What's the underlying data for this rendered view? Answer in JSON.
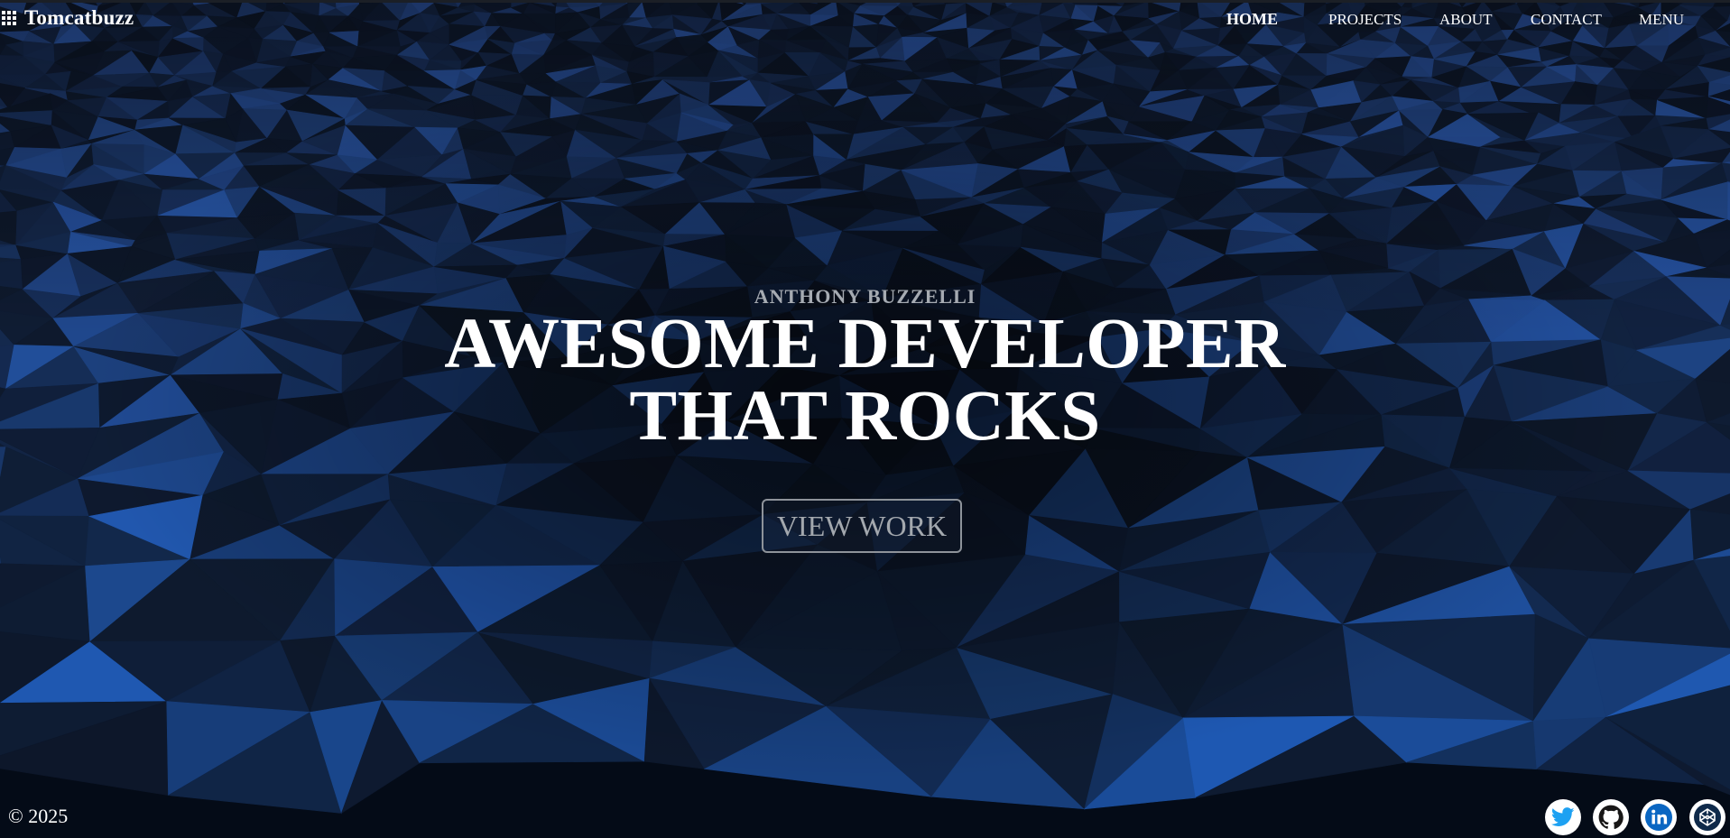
{
  "brand": {
    "name": "Tomcatbuzz",
    "icon": "apps-grid-icon"
  },
  "nav": {
    "items": [
      {
        "label": "HOME",
        "active": true
      },
      {
        "label": "PROJECTS",
        "active": false
      },
      {
        "label": "ABOUT",
        "active": false
      },
      {
        "label": "CONTACT",
        "active": false
      },
      {
        "label": "MENU",
        "active": false
      }
    ]
  },
  "hero": {
    "subtitle": "ANTHONY BUZZELLI",
    "headline_line1": "AWESOME DEVELOPER",
    "headline_line2": "THAT ROCKS",
    "cta_label": "VIEW WORK"
  },
  "footer": {
    "copyright": "© 2025",
    "socials": [
      {
        "name": "twitter-icon",
        "color": "#1da1f2"
      },
      {
        "name": "github-icon",
        "color": "#181717"
      },
      {
        "name": "linkedin-icon",
        "color": "#0a66c2"
      },
      {
        "name": "codepen-icon",
        "color": "#0f2a4a"
      }
    ]
  },
  "colors": {
    "background_dark": "#02060d",
    "background_blue": "#0b2548",
    "accent_blue": "#2f5f9e",
    "text_white": "#ffffff",
    "text_muted": "#a6abb2",
    "button_border": "#8e939a"
  }
}
